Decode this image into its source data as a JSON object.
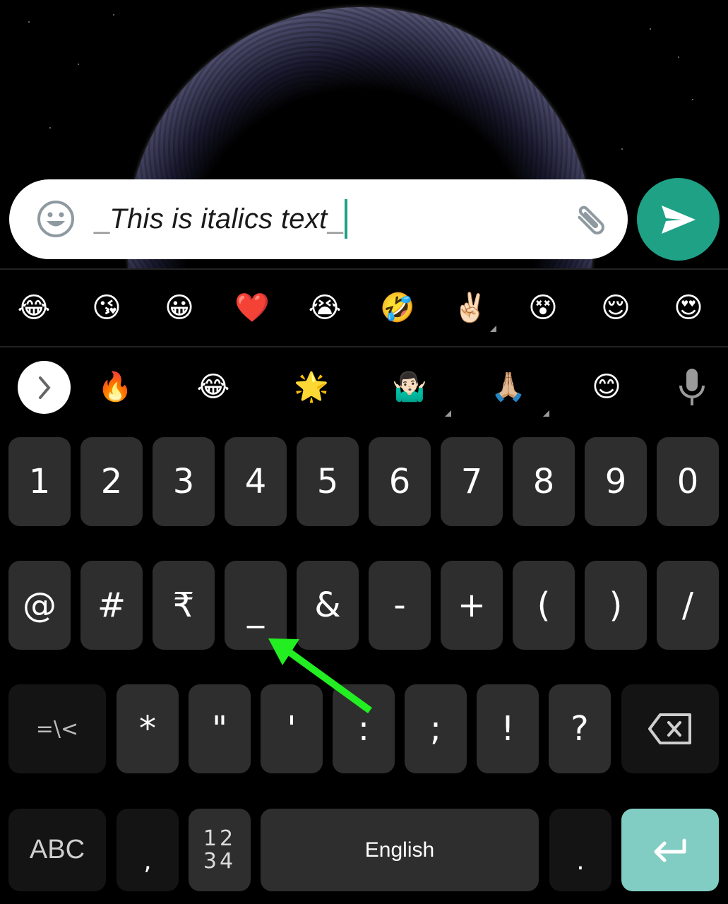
{
  "message_input": {
    "leading_marker": "_",
    "text": "This is italics text",
    "trailing_marker": "_",
    "emoji_button_icon": "smiley-face-icon",
    "attach_button_icon": "paperclip-icon"
  },
  "send_button": {
    "icon": "send-arrow-icon",
    "color": "#1fa186"
  },
  "emoji_suggestions_row1": [
    {
      "glyph": "😂",
      "name": "face-with-tears-of-joy"
    },
    {
      "glyph": "😘",
      "name": "face-blowing-kiss"
    },
    {
      "glyph": "😀",
      "name": "grinning-face"
    },
    {
      "glyph": "❤️",
      "name": "red-heart"
    },
    {
      "glyph": "😭",
      "name": "loudly-crying-face"
    },
    {
      "glyph": "🤣",
      "name": "rolling-on-floor-laughing"
    },
    {
      "glyph": "✌🏻",
      "name": "victory-hand",
      "has_variants": true
    },
    {
      "glyph": "😵",
      "name": "dizzy-face"
    },
    {
      "glyph": "😌",
      "name": "relieved-face"
    },
    {
      "glyph": "😍",
      "name": "smiling-face-heart-eyes"
    }
  ],
  "emoji_suggestions_row2": [
    {
      "glyph": "🔥",
      "name": "fire"
    },
    {
      "glyph": "😂",
      "name": "face-with-tears-of-joy"
    },
    {
      "glyph": "🌟",
      "name": "glowing-star"
    },
    {
      "glyph": "🤷🏻‍♂️",
      "name": "man-shrugging",
      "has_variants": true
    },
    {
      "glyph": "🙏🏼",
      "name": "folded-hands",
      "has_variants": true
    },
    {
      "glyph": "😊",
      "name": "smiling-face-smiling-eyes"
    }
  ],
  "toolbar": {
    "expand_icon": "chevron-right-icon",
    "mic_icon": "microphone-icon"
  },
  "keyboard": {
    "row_numbers": [
      "1",
      "2",
      "3",
      "4",
      "5",
      "6",
      "7",
      "8",
      "9",
      "0"
    ],
    "row_symbols1": [
      "@",
      "#",
      "₹",
      "_",
      "&",
      "-",
      "+",
      "(",
      ")",
      "/"
    ],
    "row_symbols2": {
      "more_symbols": "=\\<",
      "keys": [
        "*",
        "\"",
        "'",
        ":",
        ";",
        "!",
        "?"
      ],
      "backspace_icon": "backspace-icon"
    },
    "row_bottom": {
      "abc": "ABC",
      "comma": ",",
      "numpad_top": "12",
      "numpad_bottom": "34",
      "space": "English",
      "period": ".",
      "enter_icon": "enter-icon",
      "enter_color": "#81cdc3"
    }
  },
  "annotation": {
    "arrow_color": "#22ee22",
    "points_to": "_"
  }
}
